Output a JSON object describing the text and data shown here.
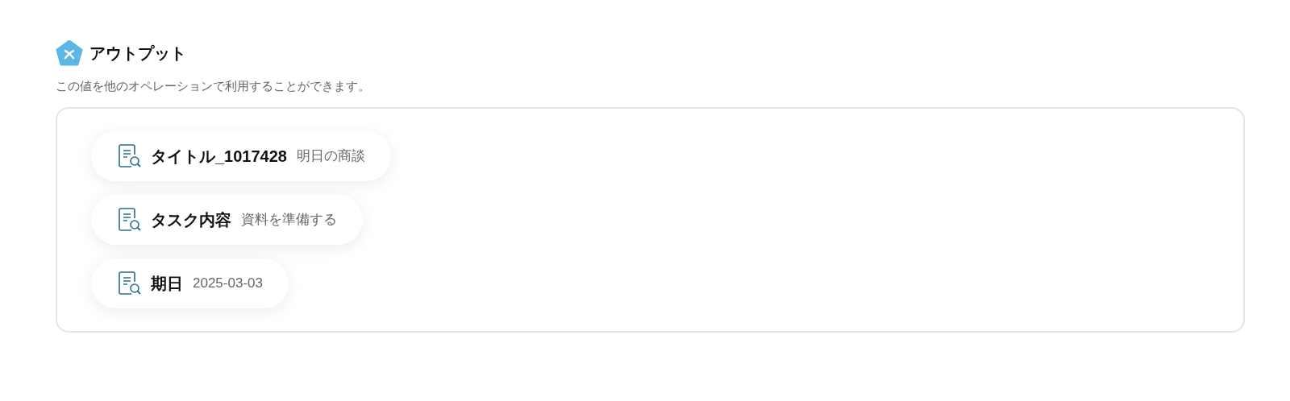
{
  "section": {
    "title": "アウトプット",
    "description": "この値を他のオペレーションで利用することができます。"
  },
  "outputs": [
    {
      "label": "タイトル_1017428",
      "value": "明日の商談"
    },
    {
      "label": "タスク内容",
      "value": "資料を準備する"
    },
    {
      "label": "期日",
      "value": "2025-03-03"
    }
  ]
}
